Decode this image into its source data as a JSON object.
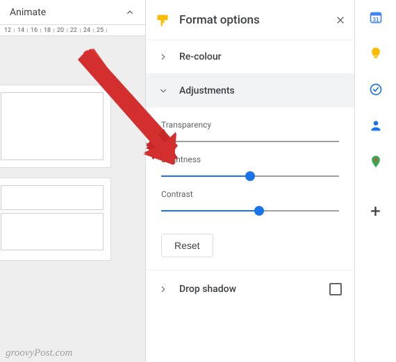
{
  "animate_label": "Animate",
  "ruler_ticks": [
    "12",
    "14",
    "16",
    "18",
    "20",
    "22",
    "24",
    "25"
  ],
  "panel": {
    "title": "Format options",
    "sections": {
      "recolor": {
        "label": "Re-colour"
      },
      "adjustments": {
        "label": "Adjustments",
        "transparency": {
          "label": "Transparency",
          "value": 0
        },
        "brightness": {
          "label": "Brightness",
          "value": 50
        },
        "contrast": {
          "label": "Contrast",
          "value": 55
        },
        "reset_label": "Reset"
      },
      "dropshadow": {
        "label": "Drop shadow",
        "checked": false
      }
    }
  },
  "watermark": "groovyPost.com"
}
